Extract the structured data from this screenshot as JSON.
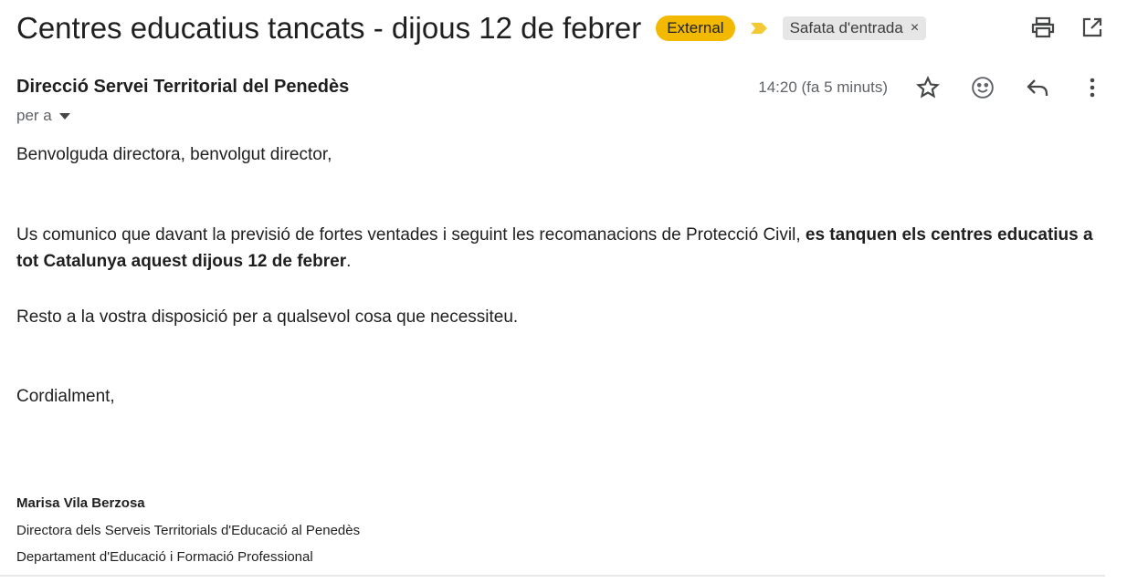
{
  "email": {
    "subject": "Centres educatius tancats - dijous 12 de febrer",
    "labels": {
      "external": "External",
      "inbox": "Safata d'entrada",
      "inbox_remove": "×"
    },
    "sender": "Direcció Servei Territorial del Penedès",
    "to_label": "per a",
    "time": "14:20 (fa 5 minuts)",
    "body": {
      "greeting": "Benvolguda directora, benvolgut director,",
      "main_plain": "Us comunico que davant la previsió de fortes ventades i seguint les recomanacions de Protecció Civil, ",
      "main_bold": "es tanquen els centres educatius a tot Catalunya aquest dijous 12  de febrer",
      "main_end": ".",
      "offer": "Resto a la vostra disposició per a qualsevol cosa que necessiteu.",
      "closing": "Cordialment,"
    },
    "signature": {
      "name": "Marisa Vila Berzosa",
      "title": "Directora dels Serveis Territorials d'Educació al Penedès",
      "department": "Departament d'Educació i Formació Professional"
    }
  },
  "icons": {
    "print": "print-icon",
    "open_new_window": "open-in-new-window-icon",
    "star": "star-icon",
    "emoji": "emoji-reaction-icon",
    "reply": "reply-icon",
    "more": "more-vert-icon",
    "importance": "importance-marker-icon",
    "dropdown": "caret-down-icon"
  },
  "colors": {
    "external_label": "#f3b900",
    "importance_marker": "#f3c935",
    "inbox_label_bg": "#e6e6e6"
  }
}
